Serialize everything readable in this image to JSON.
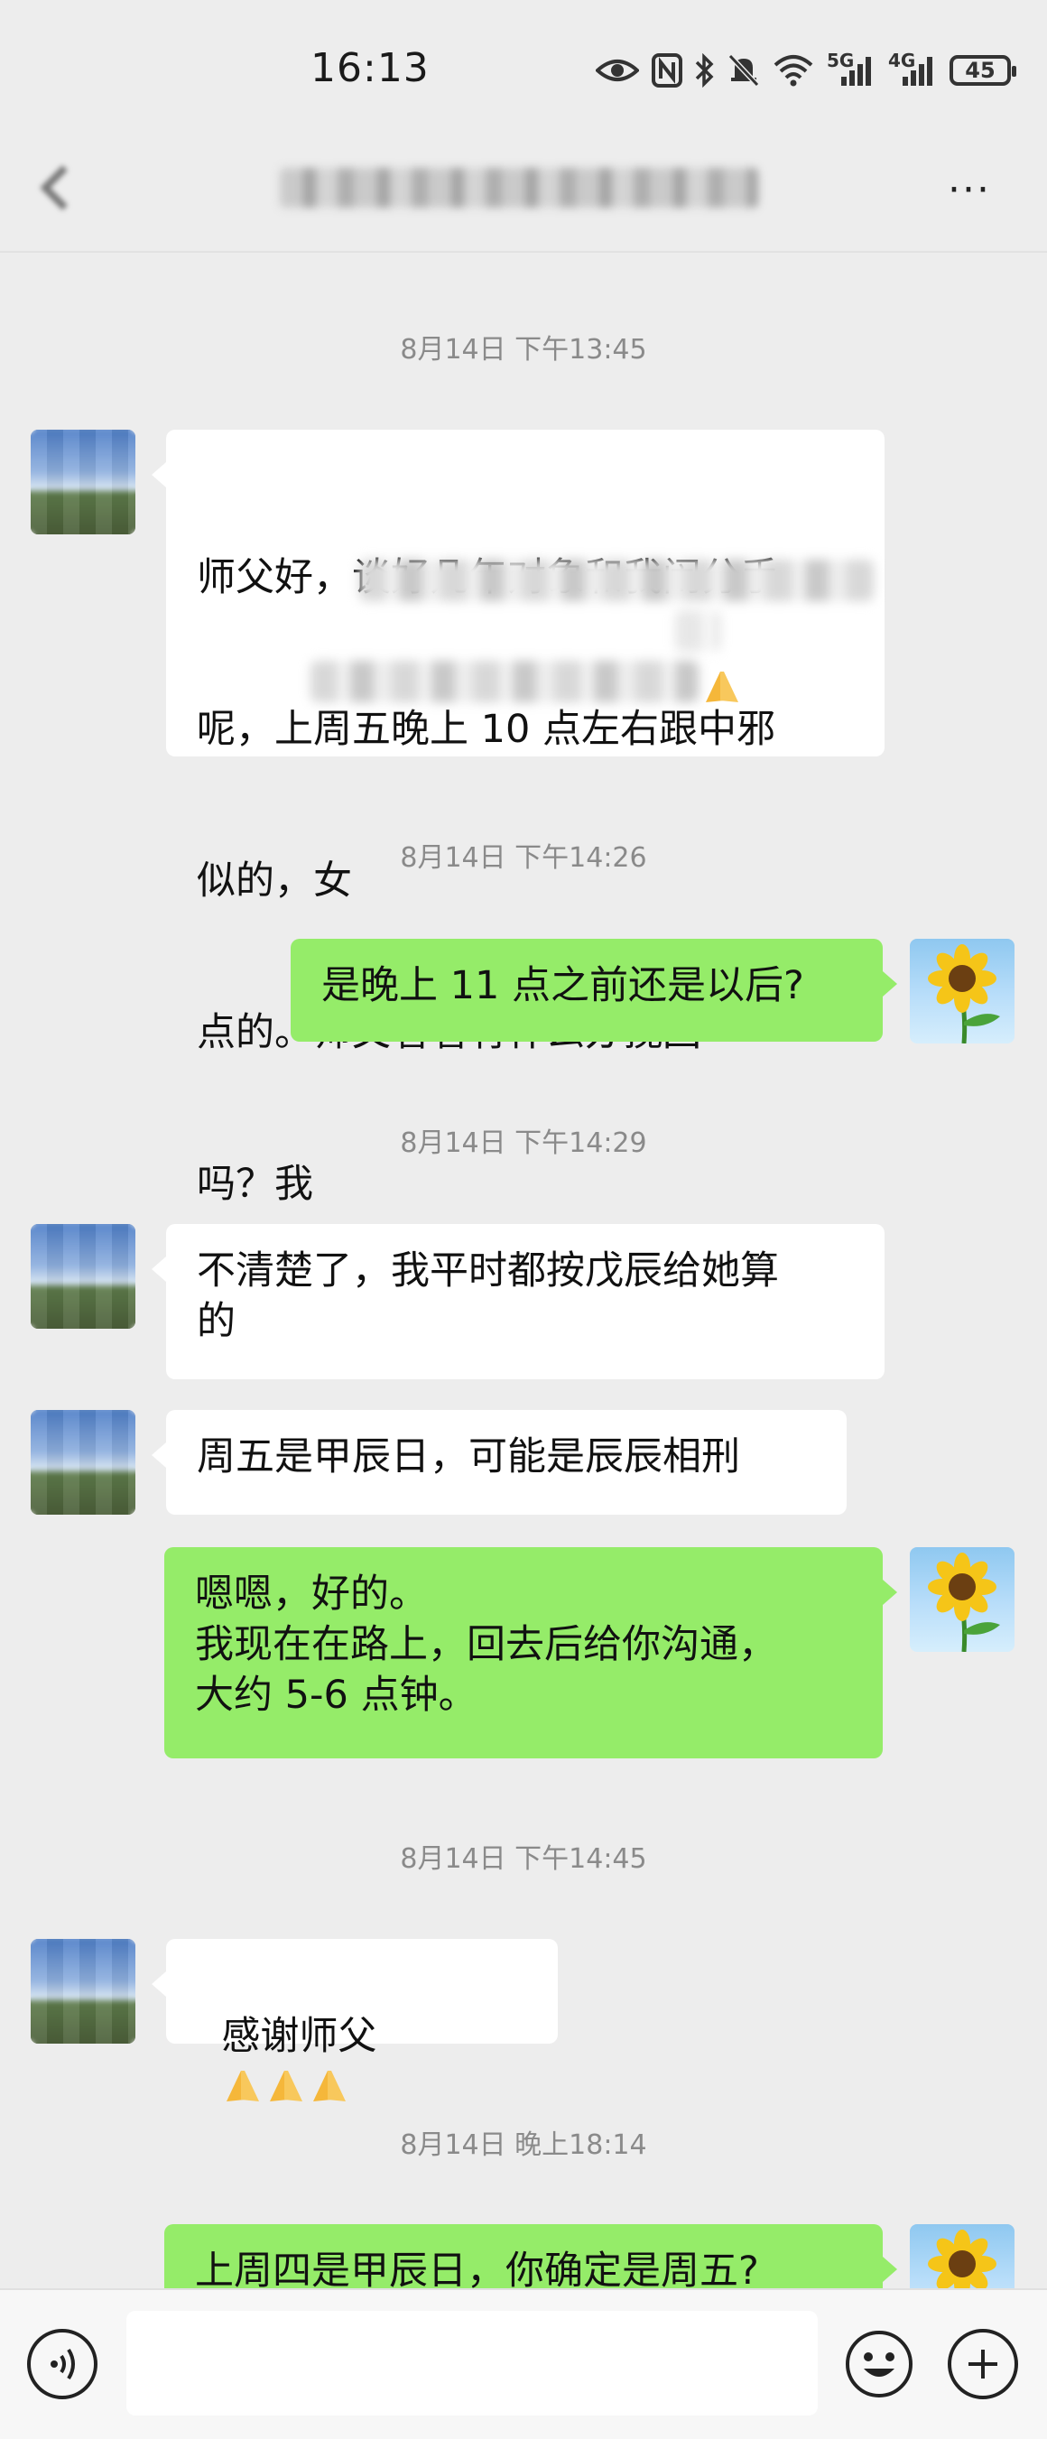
{
  "status_bar": {
    "time": "16:13",
    "battery": "45",
    "net1": "5G",
    "net2": "4G"
  },
  "header": {
    "more_label": "···"
  },
  "messages": [
    {
      "type": "timestamp",
      "text": "8月14日 下午13:45"
    },
    {
      "type": "peer",
      "lines": [
        "师父好，谈好几年对象和我闹分手",
        "呢，上周五晚上 10 点左右跟中邪",
        "似的，女",
        "点的。师父看看有什么办",
        "吗？我"
      ],
      "tail": "挽回"
    },
    {
      "type": "timestamp",
      "text": "8月14日 下午14:26"
    },
    {
      "type": "self",
      "text": "是晚上 11 点之前还是以后?"
    },
    {
      "type": "timestamp",
      "text": "8月14日 下午14:29"
    },
    {
      "type": "peer",
      "text": "不清楚了，我平时都按戊辰给她算\n的"
    },
    {
      "type": "peer",
      "text": "周五是甲辰日，可能是辰辰相刑"
    },
    {
      "type": "self",
      "text": "嗯嗯，好的。\n我现在在路上，回去后给你沟通，\n大约 5-6 点钟。"
    },
    {
      "type": "timestamp",
      "text": "8月14日 下午14:45"
    },
    {
      "type": "peer",
      "text": "感谢师父"
    },
    {
      "type": "timestamp",
      "text": "8月14日 晚上18:14"
    },
    {
      "type": "self",
      "text": "上周四是甲辰日，你确定是周五?"
    }
  ],
  "icons": {
    "back": "back-arrow-icon",
    "more": "more-dots-icon",
    "voice": "voice-icon",
    "emoji": "emoji-icon",
    "plus": "plus-icon",
    "pray": "pray-hands-emoji"
  },
  "colors": {
    "self_bubble": "#95ec69",
    "peer_bubble": "#ffffff",
    "background": "#ededed"
  }
}
